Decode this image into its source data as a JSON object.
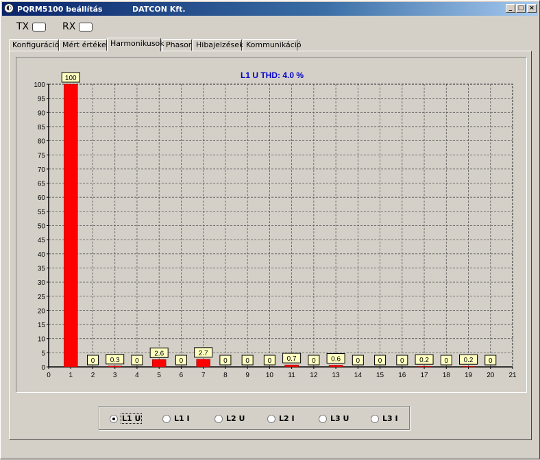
{
  "window": {
    "title": "PQRM5100 beállítás",
    "company": "DATCON Kft.",
    "minimize": "_",
    "maximize": "□",
    "close": "×"
  },
  "indicators": {
    "tx": "TX",
    "rx": "RX"
  },
  "tabs": [
    {
      "label": "Konfiguráció",
      "active": false
    },
    {
      "label": "Mért értékek",
      "active": false
    },
    {
      "label": "Harmonikusok",
      "active": true
    },
    {
      "label": "Phasor",
      "active": false
    },
    {
      "label": "Hibajelzések",
      "active": false
    },
    {
      "label": "Kommunikáció",
      "active": false
    }
  ],
  "chart_data": {
    "type": "bar",
    "title": "L1 U THD:  4.0 %",
    "x_ticks": [
      0,
      1,
      2,
      3,
      4,
      5,
      6,
      7,
      8,
      9,
      10,
      11,
      12,
      13,
      14,
      15,
      16,
      17,
      18,
      19,
      20,
      21
    ],
    "y_ticks": [
      0,
      5,
      10,
      15,
      20,
      25,
      30,
      35,
      40,
      45,
      50,
      55,
      60,
      65,
      70,
      75,
      80,
      85,
      90,
      95,
      100
    ],
    "xlim": [
      0,
      21
    ],
    "ylim": [
      0,
      100
    ],
    "categories": [
      1,
      2,
      3,
      4,
      5,
      6,
      7,
      8,
      9,
      10,
      11,
      12,
      13,
      14,
      15,
      16,
      17,
      18,
      19,
      20
    ],
    "values": [
      100,
      0,
      0.3,
      0,
      2.6,
      0,
      2.7,
      0,
      0,
      0,
      0.7,
      0,
      0.6,
      0,
      0,
      0,
      0.2,
      0,
      0.2,
      0
    ],
    "labels": [
      "100",
      "0",
      "0.3",
      "0",
      "2.6",
      "0",
      "2.7",
      "0",
      "0",
      "0",
      "0.7",
      "0",
      "0.6",
      "0",
      "0",
      "0",
      "0.2",
      "0",
      "0.2",
      "0"
    ],
    "grid": true,
    "bar_color": "#ff0000",
    "label_bg": "#ffffc0",
    "title_color": "#0000cc"
  },
  "radio_options": [
    {
      "label": "L1 U",
      "selected": true
    },
    {
      "label": "L1 I",
      "selected": false
    },
    {
      "label": "L2 U",
      "selected": false
    },
    {
      "label": "L2 I",
      "selected": false
    },
    {
      "label": "L3 U",
      "selected": false
    },
    {
      "label": "L3 I",
      "selected": false
    }
  ]
}
